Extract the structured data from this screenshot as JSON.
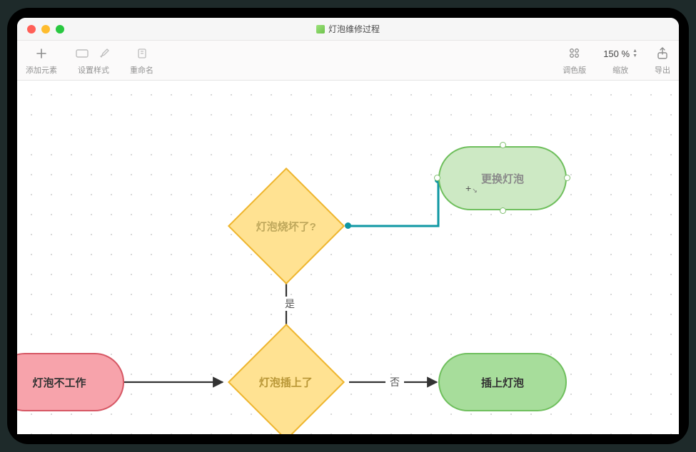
{
  "window": {
    "title": "灯泡维修过程"
  },
  "toolbar": {
    "add_element": "添加元素",
    "set_style": "设置样式",
    "rename": "重命名",
    "palette": "调色版",
    "zoom_label": "缩放",
    "zoom_value": "150 %",
    "export": "导出"
  },
  "nodes": {
    "start": "灯泡不工作",
    "plugged": "灯泡插上了",
    "burned": "灯泡烧坏了?",
    "plug_in": "插上灯泡",
    "replace": "更换灯泡"
  },
  "edges": {
    "yes": "是",
    "no": "否"
  },
  "chart_data": {
    "type": "flowchart",
    "title": "灯泡维修过程",
    "nodes": [
      {
        "id": "start",
        "shape": "terminator",
        "label": "灯泡不工作",
        "color": "red"
      },
      {
        "id": "plugged",
        "shape": "decision",
        "label": "灯泡插上了",
        "color": "yellow"
      },
      {
        "id": "burned",
        "shape": "decision",
        "label": "灯泡烧坏了?",
        "color": "yellow"
      },
      {
        "id": "plug_in",
        "shape": "terminator",
        "label": "插上灯泡",
        "color": "green"
      },
      {
        "id": "replace",
        "shape": "terminator",
        "label": "更换灯泡",
        "color": "green",
        "selected": true
      }
    ],
    "edges": [
      {
        "from": "start",
        "to": "plugged",
        "label": ""
      },
      {
        "from": "plugged",
        "to": "plug_in",
        "label": "否"
      },
      {
        "from": "plugged",
        "to": "burned",
        "label": "是"
      },
      {
        "from": "burned",
        "to": "replace",
        "label": "",
        "style": "elbow",
        "highlighted": true
      }
    ]
  }
}
